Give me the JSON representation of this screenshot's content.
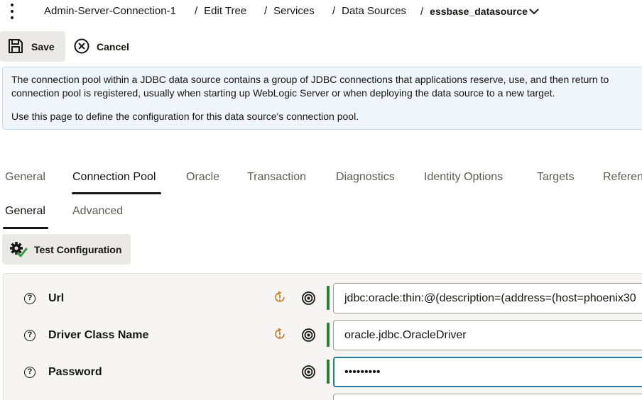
{
  "breadcrumb": {
    "items": [
      "Admin-Server-Connection-1",
      "Edit Tree",
      "Services",
      "Data Sources"
    ],
    "current": "essbase_datasource",
    "separator": "/"
  },
  "toolbar": {
    "save_label": "Save",
    "cancel_label": "Cancel"
  },
  "info": {
    "line1": "The connection pool within a JDBC data source contains a group of JDBC connections that applications reserve, use, and then return to",
    "line2": "connection pool is registered, usually when starting up WebLogic Server or when deploying the data source to a new target.",
    "line3": "Use this page to define the configuration for this data source's connection pool."
  },
  "tabs": [
    "General",
    "Connection Pool",
    "Oracle",
    "Transaction",
    "Diagnostics",
    "Identity Options",
    "Targets",
    "Referen"
  ],
  "active_tab": "Connection Pool",
  "subtabs": [
    "General",
    "Advanced"
  ],
  "active_subtab": "General",
  "test_config_label": "Test Configuration",
  "form": {
    "fields": [
      {
        "label": "Url",
        "value": "jdbc:oracle:thin:@(description=(address=(host=phoenix30",
        "has_warning": true
      },
      {
        "label": "Driver Class Name",
        "value": "oracle.jdbc.OracleDriver",
        "has_warning": true
      },
      {
        "label": "Password",
        "value": "•••••••••",
        "has_warning": false
      }
    ]
  },
  "colors": {
    "accent_bar": "#2f7d32",
    "warning": "#c77d2a",
    "info_bg": "#eef5fb",
    "focus_border": "#227e9e"
  },
  "icons": {
    "help": "help-circle-icon",
    "warning": "warning-refresh-icon",
    "target": "target-icon"
  }
}
